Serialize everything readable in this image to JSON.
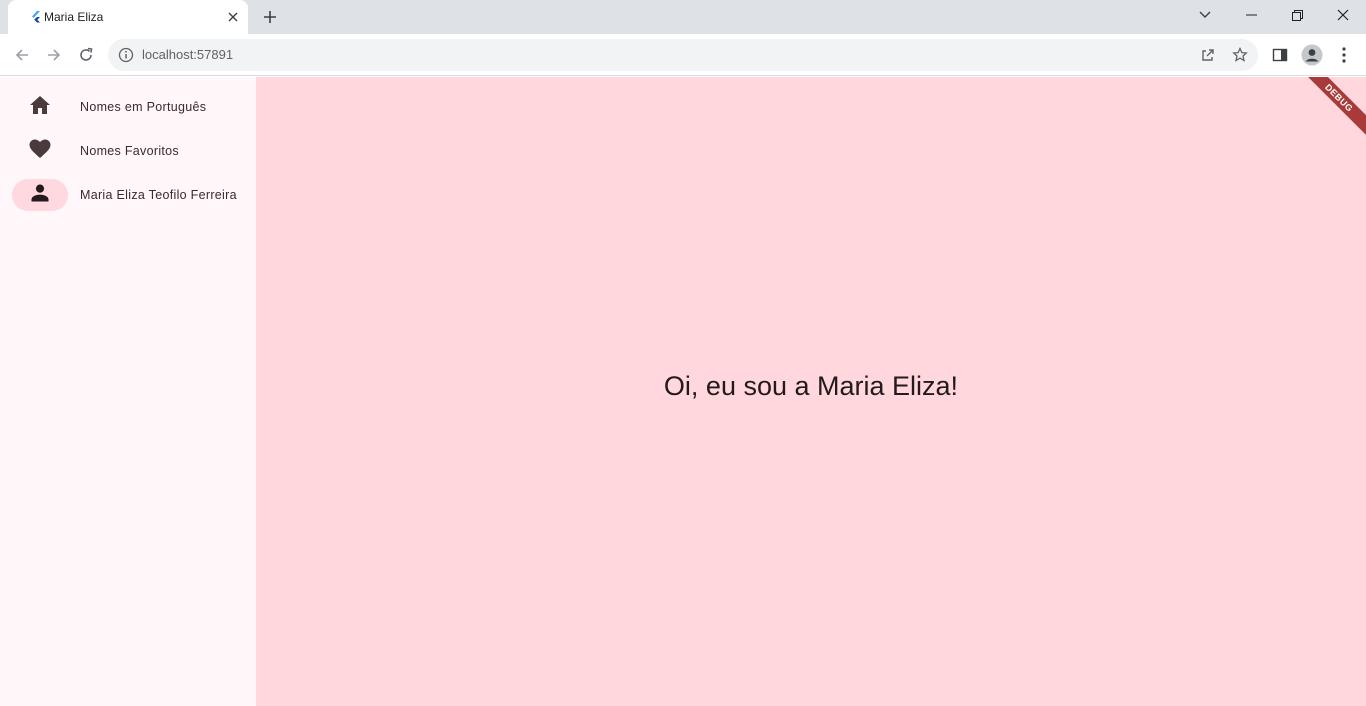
{
  "browser": {
    "tab_title": "Maria Eliza",
    "url": "localhost:57891",
    "icons": {
      "favicon": "flutter-icon",
      "tab_close": "close-icon",
      "new_tab": "plus-icon",
      "tab_search": "chevron-down-icon",
      "minimize": "minimize-icon",
      "restore": "restore-icon",
      "close_window": "close-icon",
      "back": "arrow-left-icon",
      "forward": "arrow-right-icon",
      "reload": "reload-icon",
      "site_info": "info-icon",
      "share": "share-icon",
      "bookmark": "star-icon",
      "side_panel": "side-panel-icon",
      "profile": "profile-icon",
      "menu": "kebab-menu-icon"
    }
  },
  "app": {
    "nav": [
      {
        "label": "Nomes em Português",
        "icon": "home-icon",
        "selected": false
      },
      {
        "label": "Nomes Favoritos",
        "icon": "heart-icon",
        "selected": false
      },
      {
        "label": "Maria Eliza Teofilo Ferreira",
        "icon": "person-icon",
        "selected": true
      }
    ],
    "greeting": "Oi, eu sou a Maria Eliza!",
    "debug_banner": "DEBUG",
    "colors": {
      "content_bg": "#ffd7dd",
      "rail_bg": "#fff7fa",
      "indicator": "#ffd8e0",
      "icon": "#4a3a3d",
      "debug_ribbon": "#a83a3a"
    }
  }
}
